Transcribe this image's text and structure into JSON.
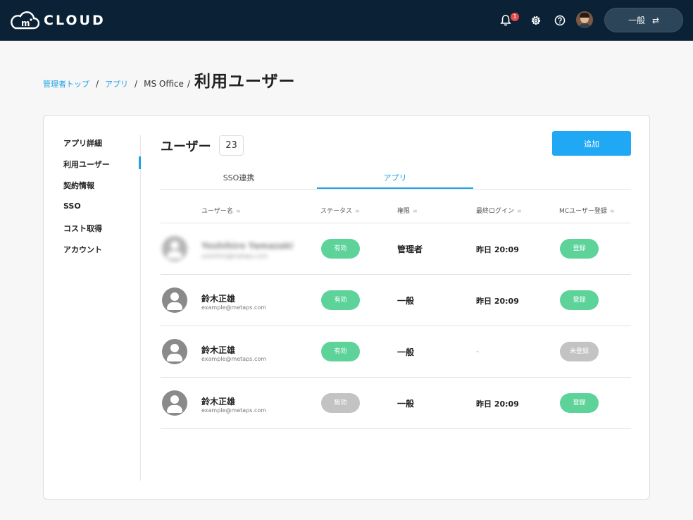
{
  "header": {
    "logo_text": "CLOUD",
    "logo_mark": "m",
    "notification_count": "1",
    "role_switch_label": "一般",
    "role_switch_icon": "swap-arrows-icon"
  },
  "breadcrumb": {
    "items": [
      "管理者トップ",
      "アプリ",
      "MS Office"
    ],
    "current": "利用ユーザー"
  },
  "sidebar": {
    "items": [
      {
        "label": "アプリ詳細"
      },
      {
        "label": "利用ユーザー",
        "active": true
      },
      {
        "label": "契約情報"
      },
      {
        "label": "SSO"
      },
      {
        "label": "コスト取得"
      },
      {
        "label": "アカウント"
      }
    ]
  },
  "main": {
    "title": "ユーザー",
    "count": "23",
    "add_label": "追加",
    "tabs": [
      {
        "label": "SSO連携"
      },
      {
        "label": "アプリ",
        "active": true
      }
    ],
    "columns": [
      "ユーザー名",
      "ステータス",
      "権限",
      "最終ログイン",
      "MCユーザー登録"
    ],
    "rows": [
      {
        "name": "Yoshihiro Yamazaki",
        "email": "yoshihiro@metaps.com",
        "status": "有効",
        "status_active": true,
        "role": "管理者",
        "last_login": "昨日 20:09",
        "mc": "登録",
        "mc_registered": true,
        "blurred": true
      },
      {
        "name": "鈴木正雄",
        "email": "example@metaps.com",
        "status": "有効",
        "status_active": true,
        "role": "一般",
        "last_login": "昨日 20:09",
        "mc": "登録",
        "mc_registered": true
      },
      {
        "name": "鈴木正雄",
        "email": "example@metaps.com",
        "status": "有効",
        "status_active": true,
        "role": "一般",
        "last_login": "-",
        "mc": "未登録",
        "mc_registered": false
      },
      {
        "name": "鈴木正雄",
        "email": "example@metaps.com",
        "status": "無効",
        "status_active": false,
        "role": "一般",
        "last_login": "昨日 20:09",
        "mc": "登録",
        "mc_registered": true
      }
    ]
  },
  "colors": {
    "header_bg": "#0b2236",
    "accent": "#1fa3e6",
    "status_green": "#5dd39a",
    "status_gray": "#c3c3c3"
  }
}
